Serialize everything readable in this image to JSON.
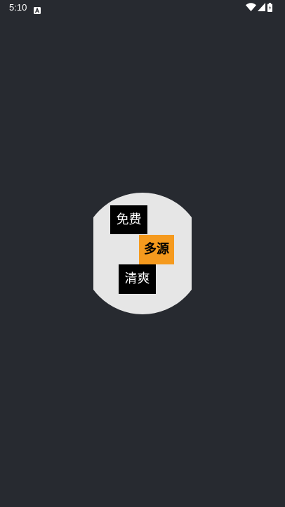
{
  "status_bar": {
    "time": "5:10",
    "notification_icon": "a-badge-icon",
    "icons": [
      "wifi-icon",
      "cell-signal-icon",
      "battery-icon"
    ]
  },
  "splash": {
    "tags": [
      {
        "label": "免费",
        "color": "#000000"
      },
      {
        "label": "多源",
        "color": "#f59a1e"
      },
      {
        "label": "清爽",
        "color": "#000000"
      }
    ]
  },
  "colors": {
    "background": "#272a30",
    "disc": "#e6e6e6",
    "accent": "#f59a1e"
  }
}
